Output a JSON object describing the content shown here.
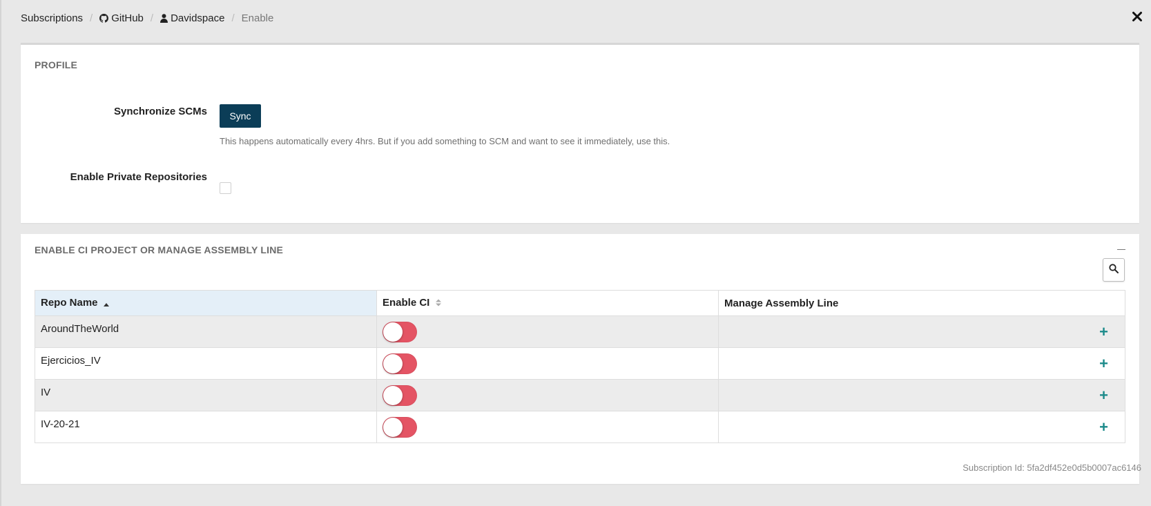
{
  "breadcrumb": {
    "items": [
      {
        "label": "Subscriptions",
        "icon": null
      },
      {
        "label": "GitHub",
        "icon": "github-icon"
      },
      {
        "label": "Davidspace",
        "icon": "user-icon"
      },
      {
        "label": "Enable",
        "icon": null
      }
    ],
    "separator": "/"
  },
  "close_icon": "close-icon",
  "profile": {
    "title": "PROFILE",
    "sync_label": "Synchronize SCMs",
    "sync_button": "Sync",
    "sync_help": "This happens automatically every 4hrs. But if you add something to SCM and want to see it immediately, use this.",
    "private_repos_label": "Enable Private Repositories",
    "private_repos_checked": false
  },
  "ci": {
    "title": "ENABLE CI PROJECT OR MANAGE ASSEMBLY LINE",
    "columns": [
      "Repo Name",
      "Enable CI",
      "Manage Assembly Line"
    ],
    "rows": [
      {
        "repo": "AroundTheWorld",
        "enable_ci": false
      },
      {
        "repo": "Ejercicios_IV",
        "enable_ci": false
      },
      {
        "repo": "IV",
        "enable_ci": false
      },
      {
        "repo": "IV-20-21",
        "enable_ci": false
      }
    ],
    "add_symbol": "+"
  },
  "subscription_id": "Subscription Id: 5fa2df452e0d5b0007ac6146",
  "colors": {
    "accent": "#0b3d57",
    "toggle_off": "#e45464",
    "plus": "#1b8a8a",
    "sorted_header": "#e4eff8"
  }
}
